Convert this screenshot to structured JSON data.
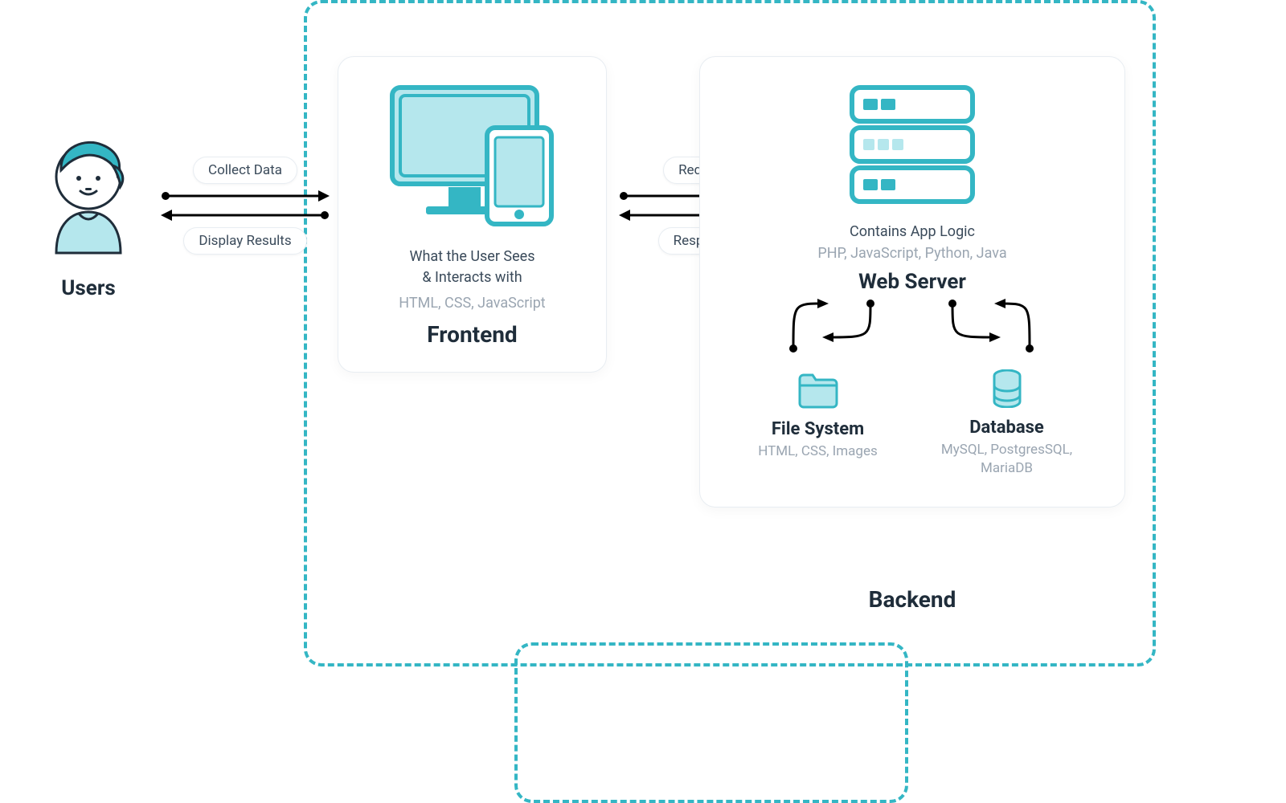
{
  "users": {
    "label": "Users"
  },
  "arrows": {
    "users_frontend": {
      "top_label": "Collect Data",
      "bottom_label": "Display Results"
    },
    "frontend_backend": {
      "top_label": "Request",
      "bottom_label": "Response"
    }
  },
  "frontend": {
    "desc_line1": "What the User Sees",
    "desc_line2": "& Interacts with",
    "tech": "HTML, CSS, JavaScript",
    "title": "Frontend"
  },
  "backend": {
    "desc": "Contains App Logic",
    "tech": "PHP, JavaScript, Python, Java",
    "web_server_label": "Web Server",
    "file_system": {
      "title": "File System",
      "tech": "HTML, CSS, Images"
    },
    "database": {
      "title": "Database",
      "tech": "MySQL, PostgresSQL, MariaDB"
    },
    "title": "Backend"
  },
  "colors": {
    "accent": "#34b6c4",
    "accent_light": "#b5e7ed",
    "text_dark": "#1f2d3a",
    "text_mid": "#3a4a5a",
    "text_grey": "#9aa5b1"
  }
}
